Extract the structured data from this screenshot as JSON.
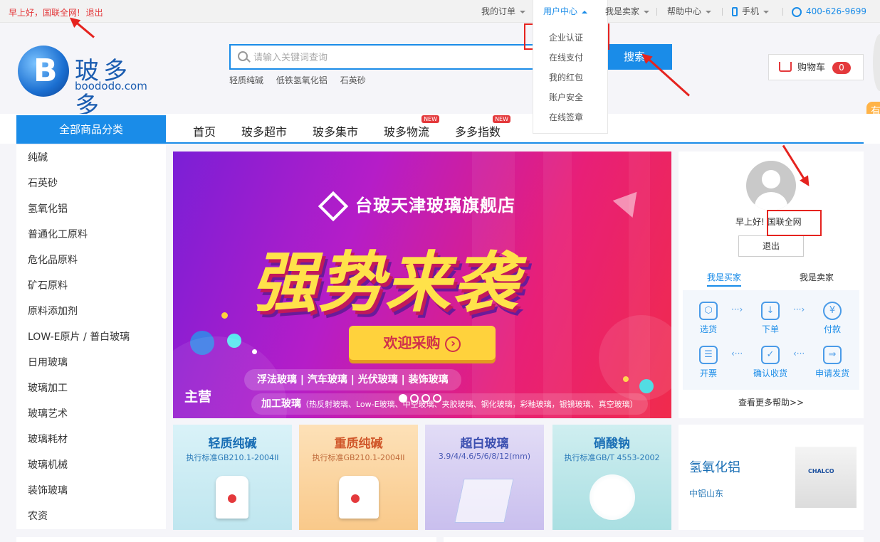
{
  "topbar": {
    "greeting": "早上好，国联全网!",
    "logout": "退出",
    "my_orders": "我的订单",
    "user_center": "用户中心",
    "seller": "我是卖家",
    "help": "帮助中心",
    "mobile": "手机",
    "phone": "400-626-9699"
  },
  "user_menu": [
    "企业认证",
    "在线支付",
    "我的红包",
    "账户安全",
    "在线签章"
  ],
  "logo": {
    "mark": "B",
    "cn": "玻多多",
    "en": "boododo.com"
  },
  "search": {
    "placeholder": "请输入关键词查询",
    "button": "搜索",
    "hot": [
      "轻质纯碱",
      "低铁氢氧化铝",
      "石英砂"
    ]
  },
  "cart": {
    "label": "购物车",
    "count": "0"
  },
  "side_tag": "有",
  "nav": {
    "all_categories": "全部商品分类",
    "items": [
      "首页",
      "玻多超市",
      "玻多集市",
      "玻多物流",
      "多多指数"
    ],
    "new_badge": "NEW"
  },
  "categories": [
    "纯碱",
    "石英砂",
    "氢氧化铝",
    "普通化工原料",
    "危化品原料",
    "矿石原料",
    "原料添加剂",
    "LOW-E原片 / 普白玻璃",
    "日用玻璃",
    "玻璃加工",
    "玻璃艺术",
    "玻璃耗材",
    "玻璃机械",
    "装饰玻璃",
    "农资"
  ],
  "banner": {
    "store": "台玻天津玻璃旗舰店",
    "headline": "强势来袭",
    "cta": "欢迎采购",
    "cta_icon": "›",
    "main_label": "主营",
    "tags": "浮法玻璃  |  汽车玻璃  |  光伏玻璃  |  装饰玻璃",
    "sub_title": "加工玻璃",
    "sub_detail": "（热反射玻璃、Low-E玻璃、中空玻璃、夹胶玻璃、钢化玻璃，彩釉玻璃，银镜玻璃、真空玻璃）"
  },
  "user_panel": {
    "greet_prefix": "早上好!",
    "username": "国联全网",
    "logout": "退出",
    "tab_buyer": "我是买家",
    "tab_seller": "我是卖家",
    "steps": [
      {
        "label": "选货",
        "icon": "⬡"
      },
      {
        "label": "下单",
        "icon": "↓"
      },
      {
        "label": "付款",
        "icon": "¥"
      },
      {
        "label": "开票",
        "icon": "☰"
      },
      {
        "label": "确认收货",
        "icon": "✓"
      },
      {
        "label": "申请发货",
        "icon": "⇒"
      }
    ],
    "more_help": "查看更多帮助>>"
  },
  "products": [
    {
      "title": "轻质纯碱",
      "sub": "执行标准GB210.1-2004II"
    },
    {
      "title": "重质纯碱",
      "sub": "执行标准GB210.1-2004II"
    },
    {
      "title": "超白玻璃",
      "sub": "3.9/4/4.6/5/6/8/12(mm)"
    },
    {
      "title": "硝酸钠",
      "sub": "执行标准GB/T 4553-2002"
    }
  ],
  "alum": {
    "title": "氢氧化铝",
    "sub": "中铝山东",
    "label_text": "CHALCO"
  },
  "colors": {
    "accent": "#1a8ce8",
    "red": "#e4393c",
    "annotation": "#e5231f"
  }
}
